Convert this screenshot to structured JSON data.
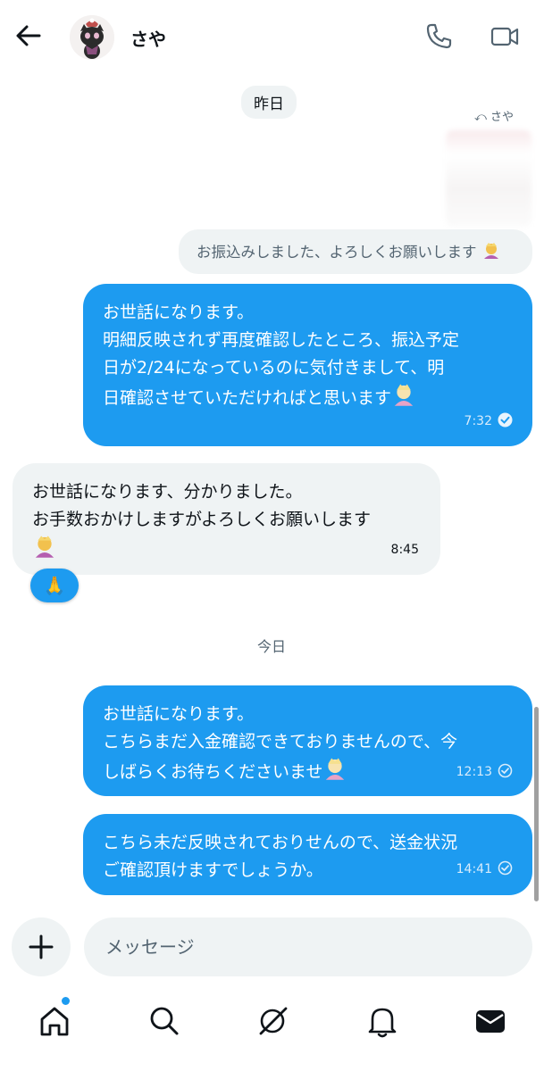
{
  "header": {
    "contact_name": "さや",
    "back_icon": "arrow-left-icon",
    "call_icon": "phone-icon",
    "video_icon": "video-camera-icon"
  },
  "messages": {
    "day1_label": "昨日",
    "reply_hint": "さや",
    "quoted_text": "お振込みしました、よろしくお願いします",
    "m1_lines": [
      "お世話になります。",
      "明細反映されず再度確認したところ、振込予定",
      "日が2/24になっているのに気付きまして、明",
      "日確認させていただければと思います"
    ],
    "m1_time": "7:32",
    "m2_lines": [
      "お世話になります、分かりました。",
      "お手数おかけしますがよろしくお願いします"
    ],
    "m2_time": "8:45",
    "reaction_emoji": "🙏",
    "day2_label": "今日",
    "m3_lines": [
      "お世話になります。",
      "こちらまだ入金確認できておりませんので、今",
      "しばらくお待ちくださいませ"
    ],
    "m3_time": "12:13",
    "m4_lines": [
      "こちら未だ反映されておりせんので、送金状況",
      "ご確認頂けますでしょうか。"
    ],
    "m4_time": "14:41"
  },
  "composer": {
    "placeholder": "メッセージ",
    "add_icon": "plus-icon"
  },
  "tabbar": {
    "items": [
      "home-icon",
      "search-icon",
      "grok-icon",
      "notifications-icon",
      "messages-icon"
    ]
  },
  "colors": {
    "accent": "#1d9bf0",
    "bubble_in": "#eff3f4",
    "muted": "#536471"
  }
}
